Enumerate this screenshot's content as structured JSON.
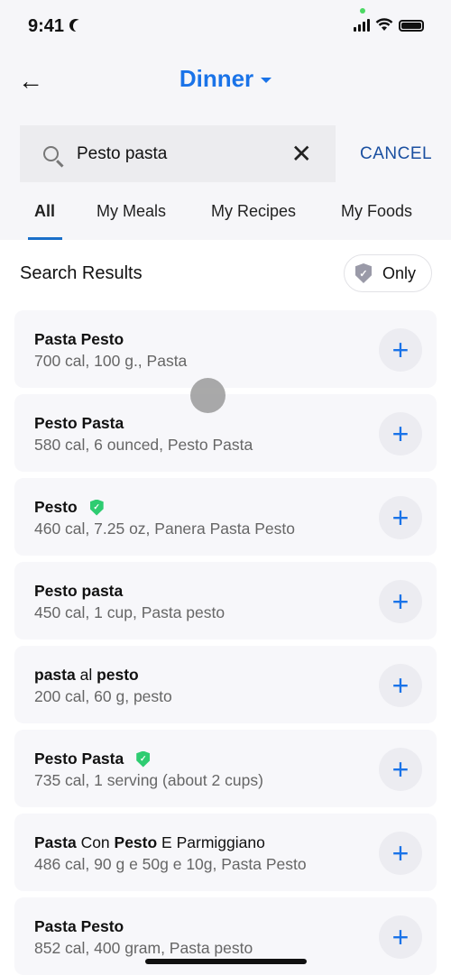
{
  "status_bar": {
    "time": "9:41"
  },
  "header": {
    "title": "Dinner"
  },
  "search": {
    "value": "Pesto pasta",
    "cancel_label": "CANCEL"
  },
  "tabs": [
    {
      "label": "All",
      "active": true
    },
    {
      "label": "My Meals"
    },
    {
      "label": "My Recipes"
    },
    {
      "label": "My Foods"
    }
  ],
  "results": {
    "heading": "Search Results",
    "filter_label": "Only"
  },
  "colors": {
    "accent": "#1a73e8",
    "verified": "#2ecc71",
    "filter_shield": "#9a9aa8"
  },
  "items": [
    {
      "title": [
        {
          "text": "Pasta",
          "bold": true
        },
        {
          "text": " "
        },
        {
          "text": "Pesto",
          "bold": true
        }
      ],
      "detail": "700 cal, 100 g., Pasta",
      "verified": false
    },
    {
      "title": [
        {
          "text": "Pesto",
          "bold": true
        },
        {
          "text": " "
        },
        {
          "text": "Pasta",
          "bold": true
        }
      ],
      "detail": "580 cal, 6 ounced, Pesto Pasta",
      "verified": false
    },
    {
      "title": [
        {
          "text": "Pesto",
          "bold": true
        }
      ],
      "detail": "460 cal, 7.25 oz, Panera Pasta Pesto",
      "verified": true
    },
    {
      "title": [
        {
          "text": "Pesto",
          "bold": true
        },
        {
          "text": " "
        },
        {
          "text": "pasta",
          "bold": true
        }
      ],
      "detail": "450 cal, 1 cup, Pasta pesto",
      "verified": false
    },
    {
      "title": [
        {
          "text": "pasta",
          "bold": true
        },
        {
          "text": " al "
        },
        {
          "text": "pesto",
          "bold": true
        }
      ],
      "detail": "200 cal, 60 g, pesto",
      "verified": false
    },
    {
      "title": [
        {
          "text": "Pesto",
          "bold": true
        },
        {
          "text": " "
        },
        {
          "text": "Pasta",
          "bold": true
        }
      ],
      "detail": "735 cal, 1 serving (about 2 cups)",
      "verified": true
    },
    {
      "title": [
        {
          "text": "Pasta",
          "bold": true
        },
        {
          "text": " Con "
        },
        {
          "text": "Pesto",
          "bold": true
        },
        {
          "text": " E Parmiggiano"
        }
      ],
      "detail": "486 cal, 90 g e 50g e 10g, Pasta Pesto",
      "verified": false
    },
    {
      "title": [
        {
          "text": "Pasta",
          "bold": true
        },
        {
          "text": " "
        },
        {
          "text": "Pesto",
          "bold": true
        }
      ],
      "detail": "852 cal, 400 gram, Pasta pesto",
      "verified": false
    }
  ]
}
